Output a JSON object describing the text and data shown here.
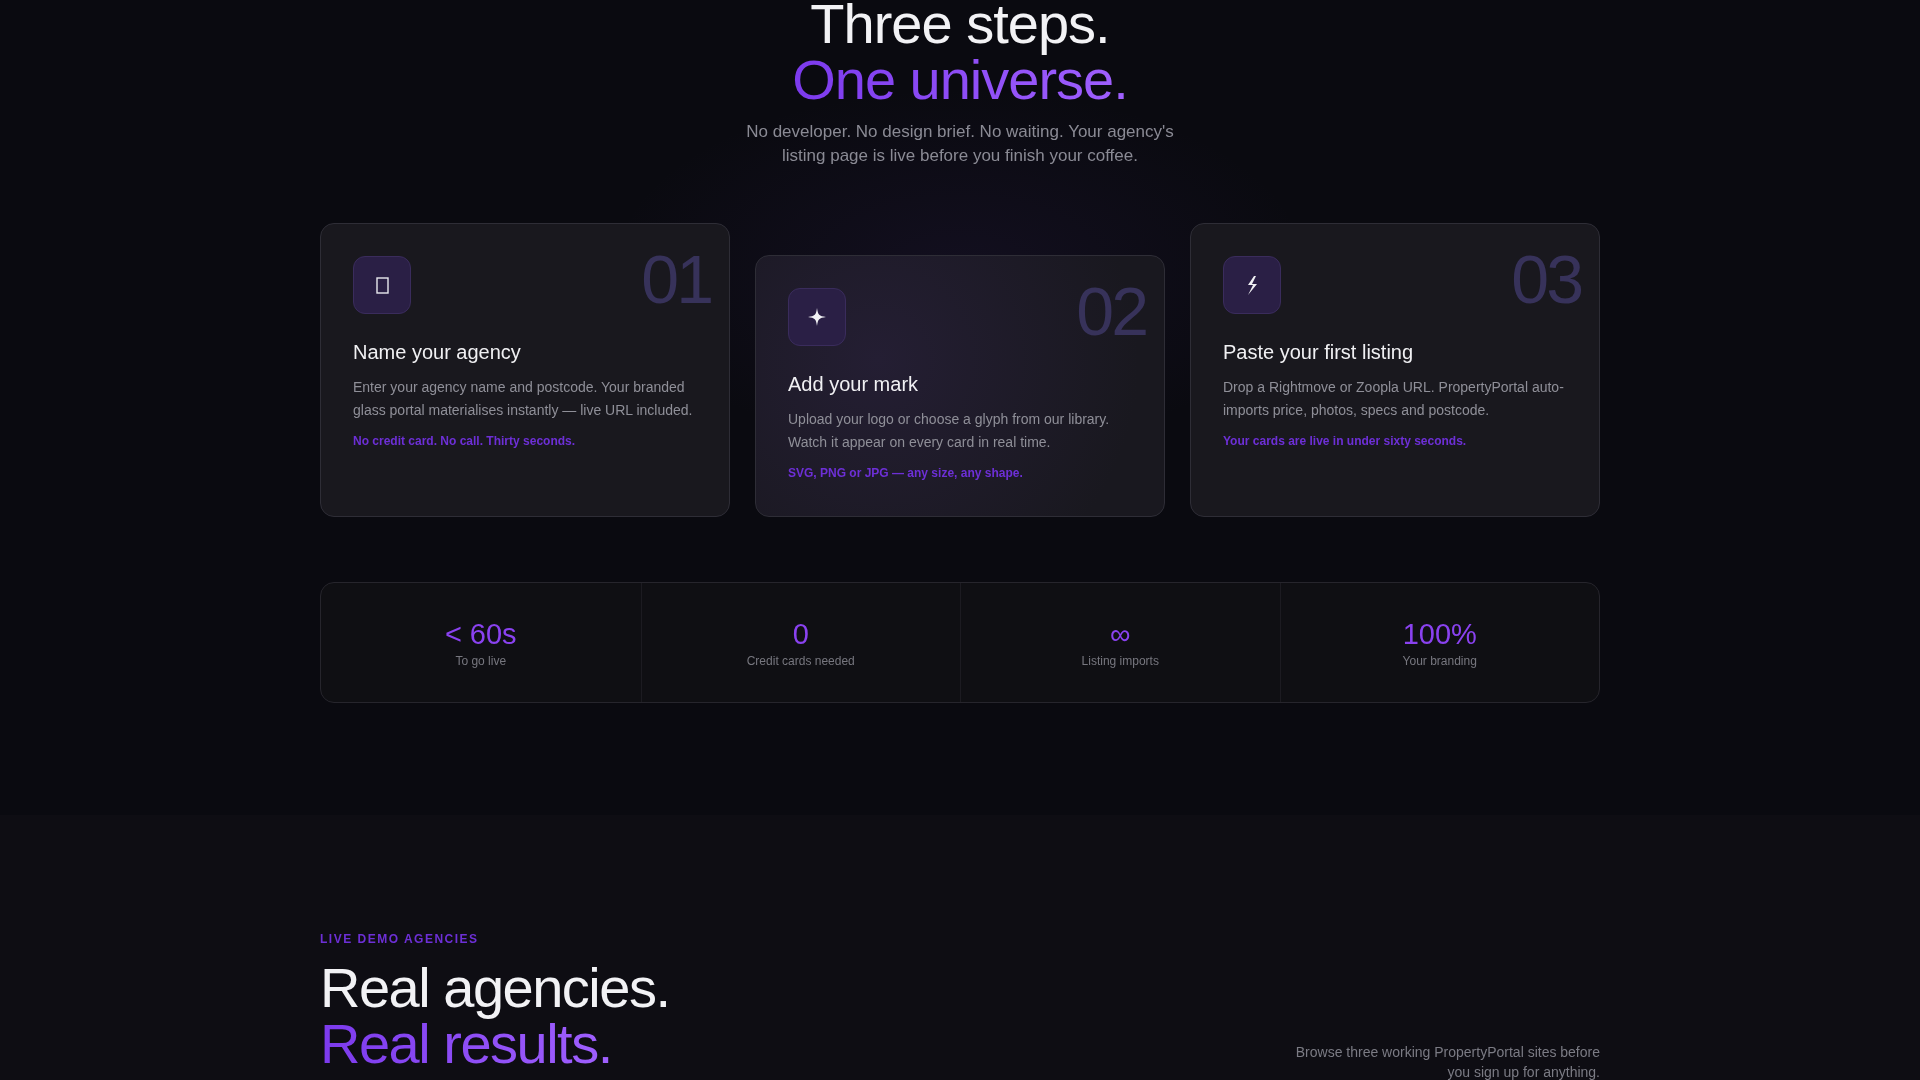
{
  "hero": {
    "title_line_1": "Three steps.",
    "title_line_2": "One universe.",
    "subtitle": "No developer. No design brief. No waiting. Your agency's listing page is live before you finish your coffee."
  },
  "steps": [
    {
      "number": "01",
      "kind": "square",
      "title": "Name your agency",
      "body": "Enter your agency name and postcode. Your branded glass portal materialises instantly — live URL included.",
      "note": "No credit card. No call. Thirty seconds.",
      "highlighted": false
    },
    {
      "number": "02",
      "kind": "sparkle",
      "title": "Add your mark",
      "body": "Upload your logo or choose a glyph from our library. Watch it appear on every card in real time.",
      "note": "SVG, PNG or JPG — any size, any shape.",
      "highlighted": true
    },
    {
      "number": "03",
      "kind": "bolt",
      "title": "Paste your first listing",
      "body": "Drop a Rightmove or Zoopla URL. PropertyPortal auto-imports price, photos, specs and postcode.",
      "note": "Your cards are live in under sixty seconds.",
      "highlighted": false
    }
  ],
  "stats": [
    {
      "value": "< 60s",
      "label": "To go live"
    },
    {
      "value": "0",
      "label": "Credit cards needed"
    },
    {
      "value": "∞",
      "label": "Listing imports"
    },
    {
      "value": "100%",
      "label": "Your branding"
    }
  ],
  "demo_section": {
    "eyebrow": "LIVE DEMO AGENCIES",
    "title_line_1": "Real agencies.",
    "title_line_2": "Real results.",
    "description": "Browse three working PropertyPortal sites before you sign up for anything."
  }
}
